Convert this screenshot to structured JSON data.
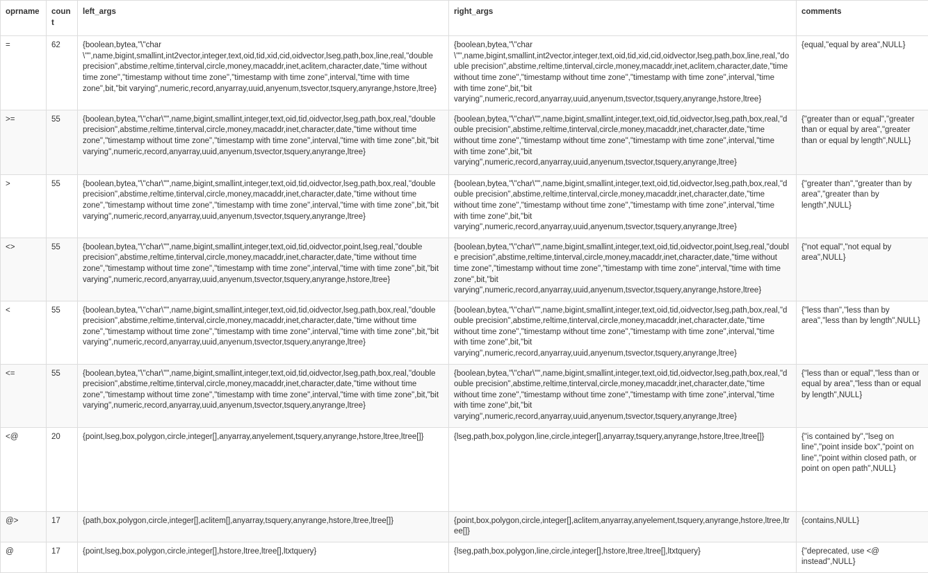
{
  "table": {
    "name": "operator-usage-table",
    "columns": [
      {
        "key": "oprname",
        "label": "oprname"
      },
      {
        "key": "count",
        "label": "count"
      },
      {
        "key": "left_args",
        "label": "left_args"
      },
      {
        "key": "right_args",
        "label": "right_args"
      },
      {
        "key": "comments",
        "label": "comments"
      }
    ],
    "rows": [
      {
        "oprname": "=",
        "count": "62",
        "left_args": "{boolean,bytea,\"\\\"char \\\"\",name,bigint,smallint,int2vector,integer,text,oid,tid,xid,cid,oidvector,lseg,path,box,line,real,\"double precision\",abstime,reltime,tinterval,circle,money,macaddr,inet,aclitem,character,date,\"time without time zone\",\"timestamp without time zone\",\"timestamp with time zone\",interval,\"time with time zone\",bit,\"bit varying\",numeric,record,anyarray,uuid,anyenum,tsvector,tsquery,anyrange,hstore,ltree}",
        "right_args": "{boolean,bytea,\"\\\"char \\\"\",name,bigint,smallint,int2vector,integer,text,oid,tid,xid,cid,oidvector,lseg,path,box,line,real,\"double precision\",abstime,reltime,tinterval,circle,money,macaddr,inet,aclitem,character,date,\"time without time zone\",\"timestamp without time zone\",\"timestamp with time zone\",interval,\"time with time zone\",bit,\"bit varying\",numeric,record,anyarray,uuid,anyenum,tsvector,tsquery,anyrange,hstore,ltree}",
        "comments": "{equal,\"equal by area\",NULL}"
      },
      {
        "oprname": ">=",
        "count": "55",
        "left_args": "{boolean,bytea,\"\\\"char\\\"\",name,bigint,smallint,integer,text,oid,tid,oidvector,lseg,path,box,real,\"double precision\",abstime,reltime,tinterval,circle,money,macaddr,inet,character,date,\"time without time zone\",\"timestamp without time zone\",\"timestamp with time zone\",interval,\"time with time zone\",bit,\"bit varying\",numeric,record,anyarray,uuid,anyenum,tsvector,tsquery,anyrange,ltree}",
        "right_args": "{boolean,bytea,\"\\\"char\\\"\",name,bigint,smallint,integer,text,oid,tid,oidvector,lseg,path,box,real,\"double precision\",abstime,reltime,tinterval,circle,money,macaddr,inet,character,date,\"time without time zone\",\"timestamp without time zone\",\"timestamp with time zone\",interval,\"time with time zone\",bit,\"bit varying\",numeric,record,anyarray,uuid,anyenum,tsvector,tsquery,anyrange,ltree}",
        "comments": "{\"greater than or equal\",\"greater than or equal by area\",\"greater than or equal by length\",NULL}"
      },
      {
        "oprname": ">",
        "count": "55",
        "left_args": "{boolean,bytea,\"\\\"char\\\"\",name,bigint,smallint,integer,text,oid,tid,oidvector,lseg,path,box,real,\"double precision\",abstime,reltime,tinterval,circle,money,macaddr,inet,character,date,\"time without time zone\",\"timestamp without time zone\",\"timestamp with time zone\",interval,\"time with time zone\",bit,\"bit varying\",numeric,record,anyarray,uuid,anyenum,tsvector,tsquery,anyrange,ltree}",
        "right_args": "{boolean,bytea,\"\\\"char\\\"\",name,bigint,smallint,integer,text,oid,tid,oidvector,lseg,path,box,real,\"double precision\",abstime,reltime,tinterval,circle,money,macaddr,inet,character,date,\"time without time zone\",\"timestamp without time zone\",\"timestamp with time zone\",interval,\"time with time zone\",bit,\"bit varying\",numeric,record,anyarray,uuid,anyenum,tsvector,tsquery,anyrange,ltree}",
        "comments": "{\"greater than\",\"greater than by area\",\"greater than by length\",NULL}"
      },
      {
        "oprname": "<>",
        "count": "55",
        "left_args": "{boolean,bytea,\"\\\"char\\\"\",name,bigint,smallint,integer,text,oid,tid,oidvector,point,lseg,real,\"double precision\",abstime,reltime,tinterval,circle,money,macaddr,inet,character,date,\"time without time zone\",\"timestamp without time zone\",\"timestamp with time zone\",interval,\"time with time zone\",bit,\"bit varying\",numeric,record,anyarray,uuid,anyenum,tsvector,tsquery,anyrange,hstore,ltree}",
        "right_args": "{boolean,bytea,\"\\\"char\\\"\",name,bigint,smallint,integer,text,oid,tid,oidvector,point,lseg,real,\"double precision\",abstime,reltime,tinterval,circle,money,macaddr,inet,character,date,\"time without time zone\",\"timestamp without time zone\",\"timestamp with time zone\",interval,\"time with time zone\",bit,\"bit varying\",numeric,record,anyarray,uuid,anyenum,tsvector,tsquery,anyrange,hstore,ltree}",
        "comments": "{\"not equal\",\"not equal by area\",NULL}"
      },
      {
        "oprname": "<",
        "count": "55",
        "left_args": "{boolean,bytea,\"\\\"char\\\"\",name,bigint,smallint,integer,text,oid,tid,oidvector,lseg,path,box,real,\"double precision\",abstime,reltime,tinterval,circle,money,macaddr,inet,character,date,\"time without time zone\",\"timestamp without time zone\",\"timestamp with time zone\",interval,\"time with time zone\",bit,\"bit varying\",numeric,record,anyarray,uuid,anyenum,tsvector,tsquery,anyrange,ltree}",
        "right_args": "{boolean,bytea,\"\\\"char\\\"\",name,bigint,smallint,integer,text,oid,tid,oidvector,lseg,path,box,real,\"double precision\",abstime,reltime,tinterval,circle,money,macaddr,inet,character,date,\"time without time zone\",\"timestamp without time zone\",\"timestamp with time zone\",interval,\"time with time zone\",bit,\"bit varying\",numeric,record,anyarray,uuid,anyenum,tsvector,tsquery,anyrange,ltree}",
        "comments": "{\"less than\",\"less than by area\",\"less than by length\",NULL}"
      },
      {
        "oprname": "<=",
        "count": "55",
        "left_args": "{boolean,bytea,\"\\\"char\\\"\",name,bigint,smallint,integer,text,oid,tid,oidvector,lseg,path,box,real,\"double precision\",abstime,reltime,tinterval,circle,money,macaddr,inet,character,date,\"time without time zone\",\"timestamp without time zone\",\"timestamp with time zone\",interval,\"time with time zone\",bit,\"bit varying\",numeric,record,anyarray,uuid,anyenum,tsvector,tsquery,anyrange,ltree}",
        "right_args": "{boolean,bytea,\"\\\"char\\\"\",name,bigint,smallint,integer,text,oid,tid,oidvector,lseg,path,box,real,\"double precision\",abstime,reltime,tinterval,circle,money,macaddr,inet,character,date,\"time without time zone\",\"timestamp without time zone\",\"timestamp with time zone\",interval,\"time with time zone\",bit,\"bit varying\",numeric,record,anyarray,uuid,anyenum,tsvector,tsquery,anyrange,ltree}",
        "comments": "{\"less than or equal\",\"less than or equal by area\",\"less than or equal by length\",NULL}"
      },
      {
        "oprname": "<@",
        "count": "20",
        "left_args": "{point,lseg,box,polygon,circle,integer[],anyarray,anyelement,tsquery,anyrange,hstore,ltree,ltree[]}",
        "right_args": "{lseg,path,box,polygon,line,circle,integer[],anyarray,tsquery,anyrange,hstore,ltree,ltree[]}",
        "comments": "{\"is contained by\",\"lseg on line\",\"point inside box\",\"point on line\",\"point within closed path, or point on open path\",NULL}"
      },
      {
        "oprname": "@>",
        "count": "17",
        "left_args": "{path,box,polygon,circle,integer[],aclitem[],anyarray,tsquery,anyrange,hstore,ltree,ltree[]}",
        "right_args": "{point,box,polygon,circle,integer[],aclitem,anyarray,anyelement,tsquery,anyrange,hstore,ltree,ltree[]}",
        "comments": "{contains,NULL}"
      },
      {
        "oprname": "@",
        "count": "17",
        "left_args": "{point,lseg,box,polygon,circle,integer[],hstore,ltree,ltree[],ltxtquery}",
        "right_args": "{lseg,path,box,polygon,line,circle,integer[],hstore,ltree,ltree[],ltxtquery}",
        "comments": "{\"deprecated, use <@ instead\",NULL}"
      }
    ]
  },
  "style": {
    "border_color": "#dddddd",
    "text_color": "#333333",
    "header_bg": "#ffffff",
    "row_alt_bg": "#f9f9f9",
    "row_bg": "#ffffff"
  }
}
